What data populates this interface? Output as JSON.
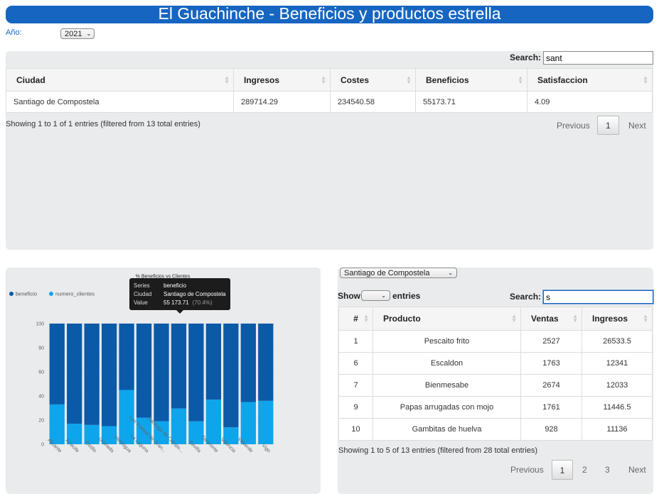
{
  "header": {
    "title": "El Guachinche - Beneficios y productos estrella"
  },
  "filters": {
    "year_label": "Año:",
    "year_value": "2021"
  },
  "cities_table": {
    "search_label": "Search:",
    "search_value": "sant",
    "columns": [
      "Ciudad",
      "Ingresos",
      "Costes",
      "Beneficios",
      "Satisfaccion"
    ],
    "rows": [
      [
        "Santiago de Compostela",
        "289714.29",
        "234540.58",
        "55173.71",
        "4.09"
      ]
    ],
    "info": "Showing 1 to 1 of 1 entries (filtered from 13 total entries)",
    "pager": {
      "previous": "Previous",
      "pages": [
        "1"
      ],
      "next": "Next"
    }
  },
  "chart_data": {
    "type": "bar",
    "title": "% Beneficios vs Clientes",
    "stacked": true,
    "categories": [
      "Alicante",
      "Arrecife",
      "Cotillo",
      "Granada",
      "Hermigua",
      "La Laguna",
      "Las Palmas de Gran...",
      "Santiago de Compo...",
      "Sevilla",
      "Tacoronte",
      "Valencia",
      "Valverde",
      "Vigo"
    ],
    "series": [
      {
        "name": "numero_clientes",
        "values": [
          33,
          17,
          16,
          15,
          45,
          22,
          19,
          29.6,
          19,
          37,
          14,
          35,
          36
        ]
      },
      {
        "name": "beneficio",
        "values": [
          67,
          83,
          84,
          85,
          55,
          78,
          81,
          70.4,
          81,
          63,
          86,
          65,
          64
        ]
      }
    ],
    "ylim": [
      0,
      100
    ],
    "yticks": [
      "0",
      "20",
      "40",
      "60",
      "80",
      "100"
    ],
    "legend": "top-left",
    "colors": {
      "beneficio": "#0b5aa8",
      "numero_clientes": "#0ea5ec"
    },
    "tooltip": {
      "series_key": "Series",
      "series_value": "beneficio",
      "city_key": "Ciudad",
      "city_value": "Santiago de Compostela",
      "value_key": "Value",
      "value_value": "55 173.71",
      "value_pct": "(70.4%)"
    }
  },
  "products_panel": {
    "city_select": "Santiago de Compostela",
    "show_label": "Show",
    "entries_label": "entries",
    "search_label": "Search:",
    "search_value": "s",
    "columns": [
      "#",
      "Producto",
      "Ventas",
      "Ingresos"
    ],
    "rows": [
      [
        "1",
        "Pescaito frito",
        "2527",
        "26533.5"
      ],
      [
        "6",
        "Escaldon",
        "1763",
        "12341"
      ],
      [
        "7",
        "Bienmesabe",
        "2674",
        "12033"
      ],
      [
        "9",
        "Papas arrugadas con mojo",
        "1761",
        "11446.5"
      ],
      [
        "10",
        "Gambitas de huelva",
        "928",
        "11136"
      ]
    ],
    "info": "Showing 1 to 5 of 13 entries (filtered from 28 total entries)",
    "pager": {
      "previous": "Previous",
      "pages": [
        "1",
        "2",
        "3"
      ],
      "next": "Next"
    }
  },
  "colors": {
    "brand": "#1665c1",
    "panel": "#e9ebed"
  }
}
